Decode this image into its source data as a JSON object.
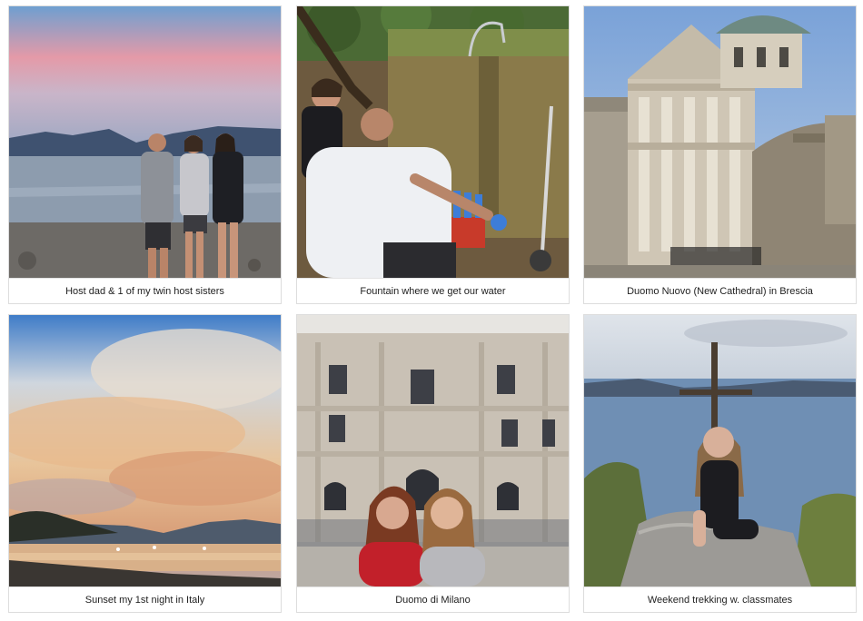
{
  "gallery": {
    "items": [
      {
        "caption": "Host dad & 1 of my twin host sisters",
        "image": "family-lakeshore-photo"
      },
      {
        "caption": "Fountain where we get our water",
        "image": "water-fountain-photo"
      },
      {
        "caption": "Duomo Nuovo (New Cathedral) in Brescia",
        "image": "cathedral-photo"
      },
      {
        "caption": "Sunset my 1st night in Italy",
        "image": "sunset-lake-photo"
      },
      {
        "caption": "Duomo di Milano",
        "image": "milan-cathedral-photo"
      },
      {
        "caption": "Weekend trekking w. classmates",
        "image": "mountain-cross-photo"
      }
    ]
  }
}
